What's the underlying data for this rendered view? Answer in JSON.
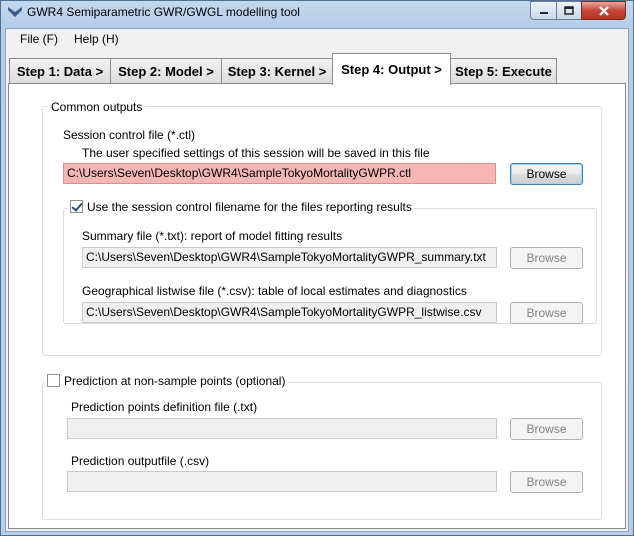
{
  "window": {
    "title": "GWR4  Semiparametric GWR/GWGL modelling tool",
    "icon": "gwr4-app-icon"
  },
  "menu": {
    "items": [
      "File (F)",
      "Help (H)"
    ]
  },
  "tabs": [
    {
      "label": "Step 1: Data >",
      "active": false
    },
    {
      "label": "Step 2: Model >",
      "active": false
    },
    {
      "label": "Step 3: Kernel >",
      "active": false
    },
    {
      "label": "Step 4: Output >",
      "active": true
    },
    {
      "label": "Step 5: Execute",
      "active": false
    }
  ],
  "common_outputs": {
    "title": "Common outputs",
    "session_label": "Session control file (*.ctl)",
    "session_desc": "The user specified settings of this session will be saved in this file",
    "session_value": "C:\\Users\\Seven\\Desktop\\GWR4\\SampleTokyoMortalityGWPR.ctl",
    "session_browse": "Browse",
    "use_session_checkbox": {
      "label": "Use the session control filename for the files reporting results",
      "checked": true
    },
    "summary_label": "Summary file (*.txt): report of model fitting results",
    "summary_value": "C:\\Users\\Seven\\Desktop\\GWR4\\SampleTokyoMortalityGWPR_summary.txt",
    "summary_browse": "Browse",
    "listwise_label": "Geographical listwise file (*.csv): table of local estimates and diagnostics",
    "listwise_value": "C:\\Users\\Seven\\Desktop\\GWR4\\SampleTokyoMortalityGWPR_listwise.csv",
    "listwise_browse": "Browse"
  },
  "prediction": {
    "checkbox": {
      "label": "Prediction at non-sample points (optional)",
      "checked": false
    },
    "points_label": "Prediction points definition file (.txt)",
    "points_value": "",
    "points_browse": "Browse",
    "output_label": "Prediction outputfile (.csv)",
    "output_value": "",
    "output_browse": "Browse"
  },
  "colors": {
    "highlight_field": "#f5b6b6",
    "title_bar": "#b9cfe9",
    "close_button": "#c7453a"
  }
}
